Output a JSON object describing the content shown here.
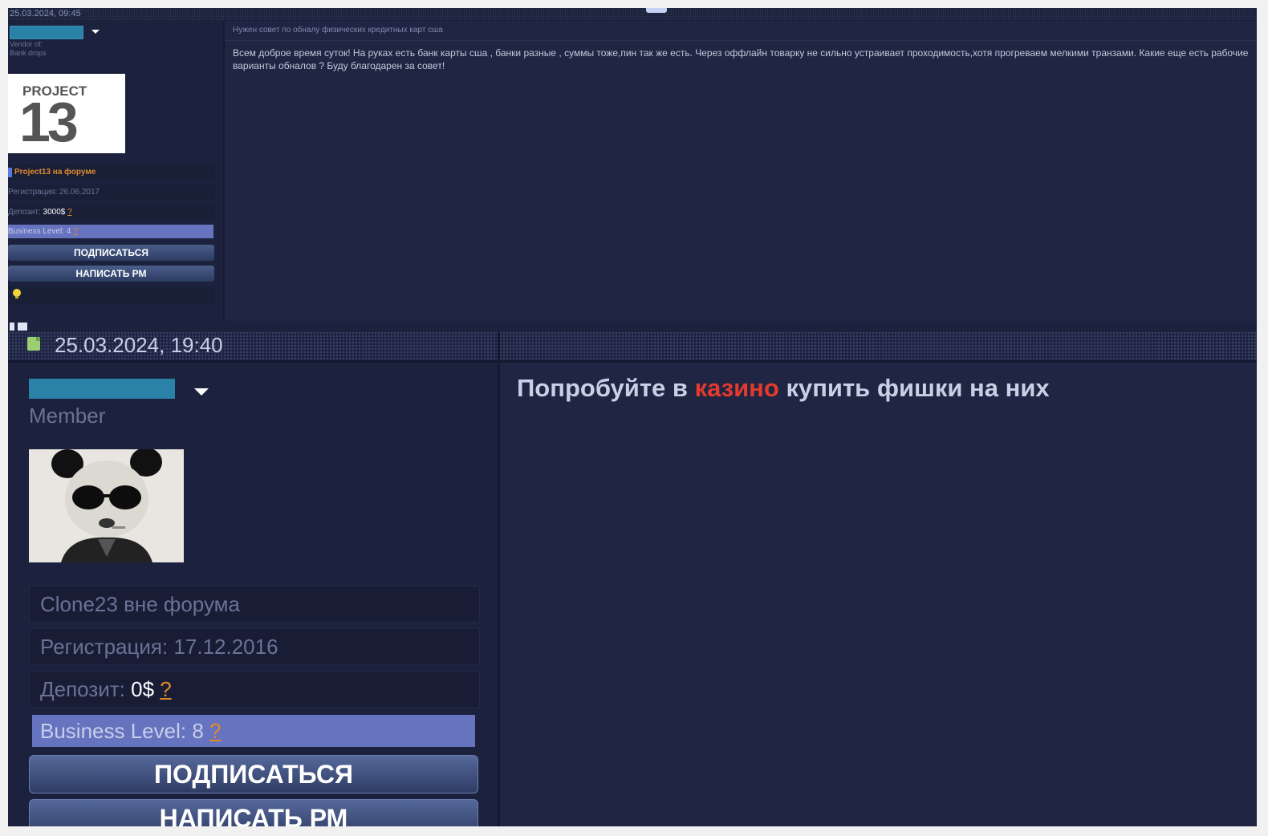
{
  "post1": {
    "date": "25.03.2024, 09:45",
    "user_title": "Vendor of:",
    "user_subtitle": "Bank drops",
    "avatar": {
      "line1": "PROJECT",
      "line2": "13"
    },
    "online_status": "Project13 на форуме",
    "registration": "Регистрация: 26.06.2017",
    "deposit_label": "Депозит:",
    "deposit_value": "3000$",
    "help_mark": "?",
    "business_level_label": "Business Level:",
    "business_level_value": "4",
    "subscribe_label": "ПОДПИСАТЬСЯ",
    "pm_label": "НАПИСАТЬ РМ",
    "subject": "Нужен совет по обналу физических кредитных карт сша",
    "message": "Всем доброе время суток! На руках есть банк карты сша , банки разные , суммы тоже,пин так же есть. Через оффлайн товарку не сильно устраивает проходимость,хотя прогреваем мелкими транзами. Какие еще есть рабочие варианты обналов ? Буду благодарен за совет!"
  },
  "post2": {
    "date": "25.03.2024, 19:40",
    "user_title": "Member",
    "online_status": "Clone23 вне форума",
    "registration": "Регистрация: 17.12.2016",
    "deposit_label": "Депозит:",
    "deposit_value": "0$",
    "help_mark": "?",
    "business_level_label": "Business Level:",
    "business_level_value": "8",
    "subscribe_label": "ПОДПИСАТЬСЯ",
    "pm_label": "НАПИСАТЬ РМ",
    "message_before": "Попробуйте в ",
    "message_highlight": "казино",
    "message_after": " купить фишки на них"
  },
  "colors": {
    "background": "#1c223d",
    "username_redacted": "#2a82a8",
    "business_level_bg": "#6673bf",
    "help_link": "#e08a2c",
    "online_orange": "#e08a2c",
    "highlight_red": "#e33a2e"
  },
  "icons": {
    "post_date": "document-icon",
    "user_menu": "caret-down-icon",
    "reputation": "lightbulb-icon"
  }
}
